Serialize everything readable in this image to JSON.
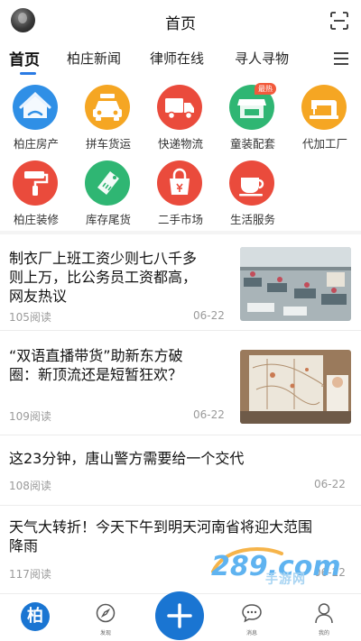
{
  "header": {
    "title": "首页"
  },
  "tabs": [
    {
      "label": "首页"
    },
    {
      "label": "柏庄新闻"
    },
    {
      "label": "律师在线"
    },
    {
      "label": "寻人寻物"
    }
  ],
  "grid": [
    {
      "label": "柏庄房产",
      "icon": "house-icon",
      "color": "#2f8fe6"
    },
    {
      "label": "拼车货运",
      "icon": "taxi-icon",
      "color": "#f5a623"
    },
    {
      "label": "快递物流",
      "icon": "truck-icon",
      "color": "#ea4b3c"
    },
    {
      "label": "童装配套",
      "icon": "store-icon",
      "color": "#2fb673",
      "badge": "最热"
    },
    {
      "label": "代加工厂",
      "icon": "sewing-machine-icon",
      "color": "#f5a623"
    },
    {
      "label": "柏庄装修",
      "icon": "paint-roller-icon",
      "color": "#ea4b3c"
    },
    {
      "label": "库存尾货",
      "icon": "sell-tag-icon",
      "color": "#2fb673"
    },
    {
      "label": "二手市场",
      "icon": "shopping-bag-icon",
      "color": "#ea4b3c"
    },
    {
      "label": "生活服务",
      "icon": "coffee-cup-icon",
      "color": "#ea4b3c"
    }
  ],
  "news": [
    {
      "title_lines": [
        "制衣厂上班工资少则七八千多",
        "则上万，比公务员工资都高，",
        "网友热议"
      ],
      "reads": "105阅读",
      "date": "06-22",
      "has_image": true
    },
    {
      "title_lines": [
        "“双语直播带货”助新东方破",
        "圈：新顶流还是短暂狂欢？"
      ],
      "reads": "109阅读",
      "date": "06-22",
      "has_image": true
    },
    {
      "title_lines": [
        "这23分钟，唐山警方需要给一个交代"
      ],
      "reads": "108阅读",
      "date": "06-22",
      "has_image": false
    },
    {
      "title_lines": [
        "天气大转折！今天下午到明天河南省将迎大范围",
        "降雨"
      ],
      "reads": "117阅读",
      "date": "06-22",
      "has_image": false
    }
  ],
  "bottom_nav": {
    "home_glyph": "柏",
    "discover": "发现",
    "messages": "消息",
    "mine": "我的"
  },
  "watermark": {
    "text": "手游网",
    "logo": "289.com"
  },
  "colors": {
    "accent": "#2a7be4",
    "plus": "#1a75d2"
  }
}
